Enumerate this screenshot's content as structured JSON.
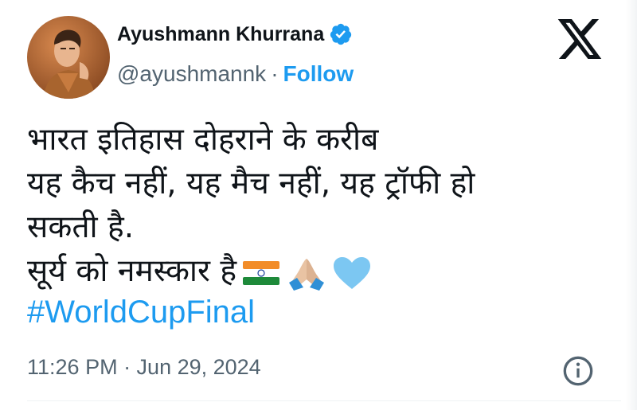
{
  "author": {
    "display_name": "Ayushmann Khurrana",
    "handle": "@ayushmannk",
    "separator": "·",
    "follow_label": "Follow",
    "verified": true
  },
  "tweet": {
    "lines": [
      "भारत इतिहास दोहराने के करीब",
      "यह कैच नहीं, यह मैच नहीं, यह ट्रॉफी हो",
      "सकती है.",
      "सूर्य को नमस्कार है"
    ],
    "emojis": [
      "indian-flag",
      "folded-hands",
      "light-blue-heart"
    ],
    "hashtag": "#WorldCupFinal"
  },
  "timestamp": "11:26 PM · Jun 29, 2024",
  "colors": {
    "accent": "#1d9bf0",
    "text": "#0f1419",
    "muted": "#536471"
  }
}
